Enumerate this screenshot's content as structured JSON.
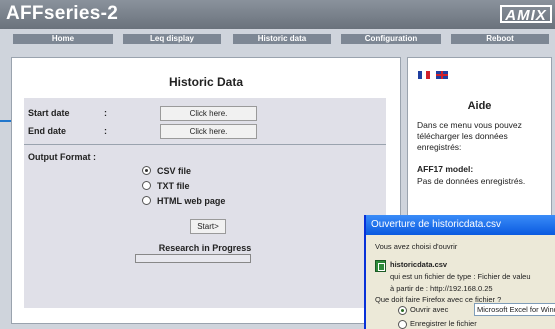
{
  "app": {
    "title": "AFFseries-2",
    "logo_text": "AMIX"
  },
  "nav": [
    {
      "label": "Home"
    },
    {
      "label": "Leq display"
    },
    {
      "label": "Historic data"
    },
    {
      "label": "Configuration"
    },
    {
      "label": "Reboot"
    }
  ],
  "main": {
    "title": "Historic Data",
    "start_date_label": "Start date",
    "end_date_label": "End date",
    "colon": ":",
    "start_button": "Click here.",
    "end_button": "Click here.",
    "output_format_label": "Output Format",
    "formats": [
      {
        "label": "CSV file",
        "selected": true
      },
      {
        "label": "TXT file",
        "selected": false
      },
      {
        "label": "HTML web page",
        "selected": false
      }
    ],
    "start_action": "Start>",
    "research_status": "Research in Progress"
  },
  "help": {
    "title": "Aide",
    "text": "Dans ce menu vous pouvez télécharger les données enregistrés:",
    "model_label": "AFF17 model:",
    "model_text": "Pas de données enregistrés."
  },
  "dialog": {
    "title": "Ouverture de historicdata.csv",
    "chosen_text": "Vous avez choisi d'ouvrir",
    "filename": "historicdata.csv",
    "filetype_text": "qui est un fichier de type : Fichier de valeu",
    "source_text": "à partir de : http://192.168.0.25",
    "question": "Que doit faire Firefox avec ce fichier ?",
    "open_with_label": "Ouvrir avec",
    "open_with_value": "Microsoft Excel for Window",
    "save_label": "Enregistrer le fichier"
  },
  "colors": {
    "header": "#6a727c",
    "nav_button": "#7d8794",
    "dialog_title": "#0a5ae0",
    "arrow": "#2277cc"
  }
}
